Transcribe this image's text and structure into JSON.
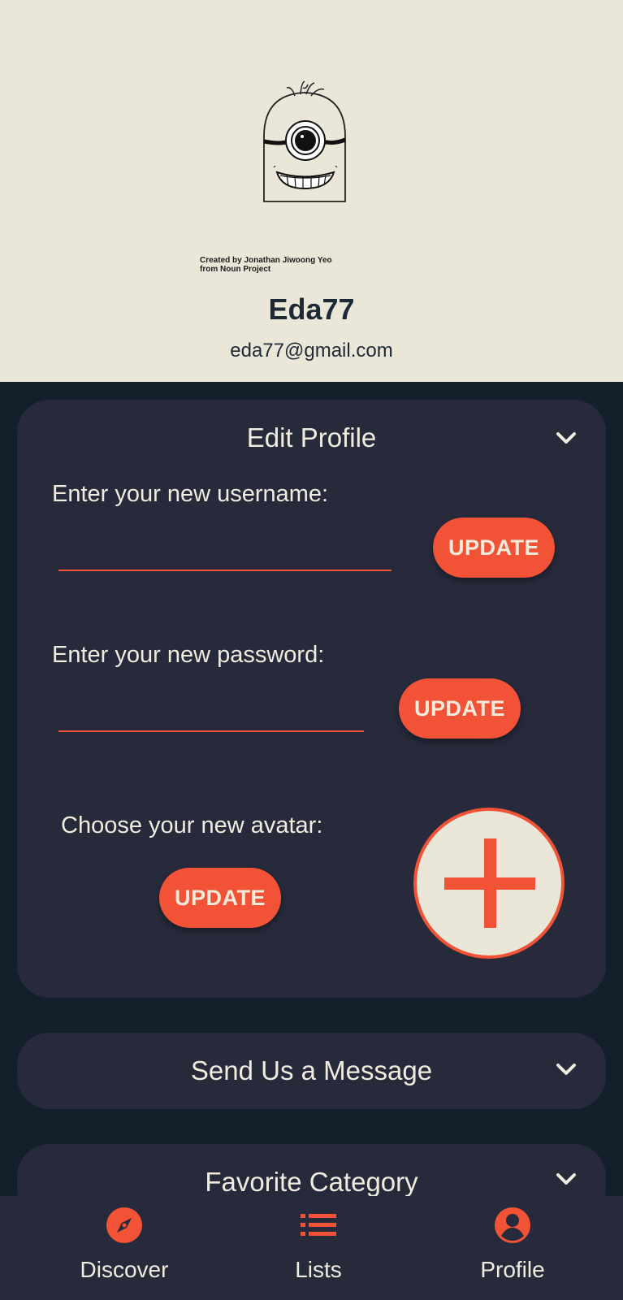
{
  "header": {
    "credit_line1": "Created by Jonathan Jiwoong Yeo",
    "credit_line2": "from Noun Project",
    "username": "Eda77",
    "email": "eda77@gmail.com"
  },
  "edit_profile": {
    "title": "Edit Profile",
    "username_label": "Enter your new username:",
    "username_value": "",
    "password_label": "Enter your new password:",
    "password_value": "",
    "avatar_label": "Choose your new avatar:",
    "update_label": "UPDATE"
  },
  "message_section": {
    "title": "Send Us a Message"
  },
  "favorite_section": {
    "title": "Favorite Category"
  },
  "nav": {
    "items": [
      {
        "label": "Discover",
        "icon": "compass-icon"
      },
      {
        "label": "Lists",
        "icon": "list-icon"
      },
      {
        "label": "Profile",
        "icon": "account-icon"
      }
    ]
  },
  "colors": {
    "accent": "#f25236",
    "background": "#13202b",
    "card": "#262a3a",
    "header": "#ebe7d8"
  }
}
